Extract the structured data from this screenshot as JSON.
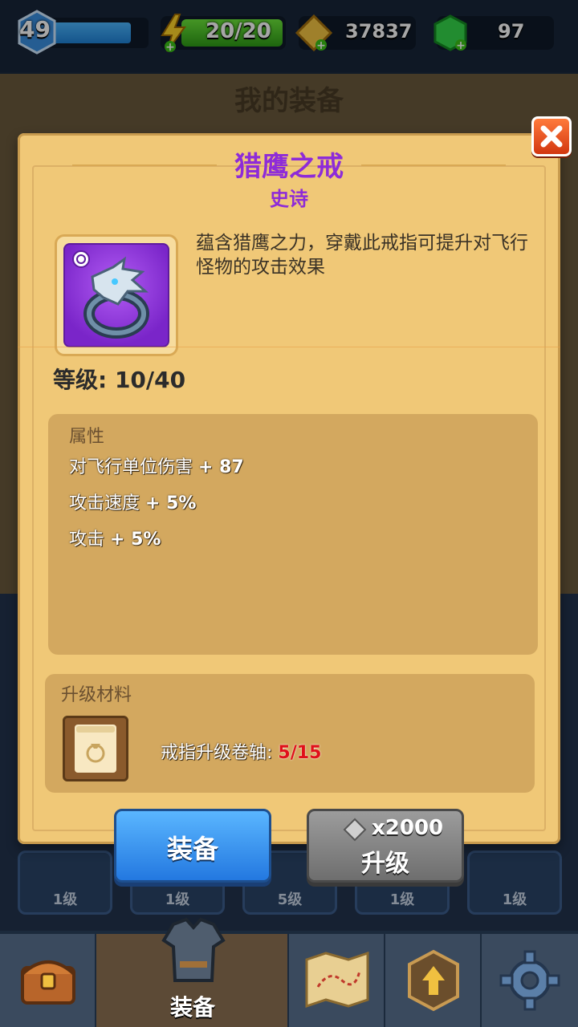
{
  "hud": {
    "level": "49",
    "xp_fraction": 0.85,
    "energy": "20/20",
    "gold": "37837",
    "gems": "97"
  },
  "background": {
    "title": "我的装备",
    "slot_levels": [
      "1级",
      "1级",
      "5级",
      "1级",
      "1级"
    ]
  },
  "item": {
    "name": "猎鹰之戒",
    "rarity": "史诗",
    "description": "蕴含猎鹰之力，穿戴此戒指可提升对飞行怪物的攻击效果",
    "level_text": "等级: 10/40"
  },
  "attributes": {
    "header": "属性",
    "rows": [
      {
        "label": "对飞行单位伤害",
        "value": "+ 87"
      },
      {
        "label": "攻击速度",
        "value": "+ 5%"
      },
      {
        "label": "攻击",
        "value": "+ 5%"
      }
    ]
  },
  "materials": {
    "header": "升级材料",
    "item_label": "戒指升级卷轴:",
    "count": "5/15"
  },
  "buttons": {
    "equip": "装备",
    "upgrade_cost": "x2000",
    "upgrade": "升级"
  },
  "nav": {
    "active_label": "装备"
  },
  "colors": {
    "rarity_epic": "#8e2bd8",
    "modal_bg": "#f0c877",
    "equip_button": "#2f8cf0",
    "upgrade_button": "#8a8a8a"
  }
}
